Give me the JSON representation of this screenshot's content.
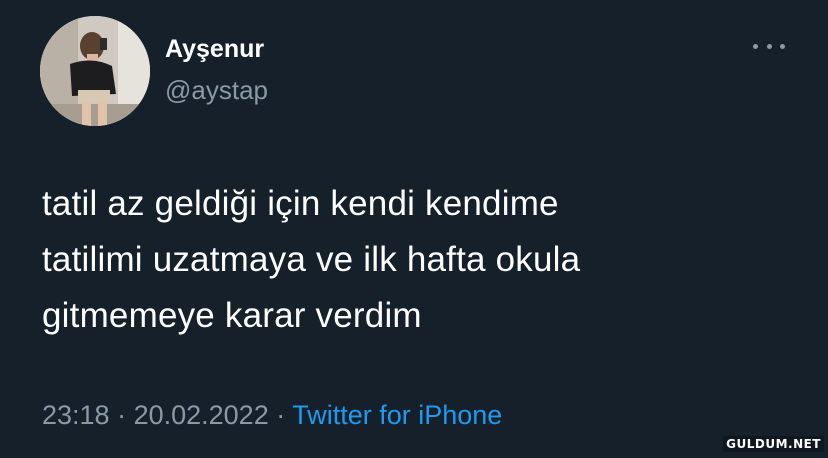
{
  "tweet": {
    "display_name": "Ayşenur",
    "handle": "@aystap",
    "text": "tatil az geldiği için kendi kendime\ntatilimi uzatmaya ve ilk hafta okula\ngitmemeye karar verdim",
    "time": "23:18",
    "separator_1": " · ",
    "date": "20.02.2022",
    "separator_2": " · ",
    "source": "Twitter for iPhone"
  },
  "icons": {
    "more": "more-horizontal-icon",
    "avatar": "profile-photo"
  },
  "colors": {
    "background": "#15202b",
    "primary_text": "#ffffff",
    "secondary_text": "#8b98a5",
    "link": "#1d9bf0"
  },
  "watermark": "GULDUM.NET"
}
